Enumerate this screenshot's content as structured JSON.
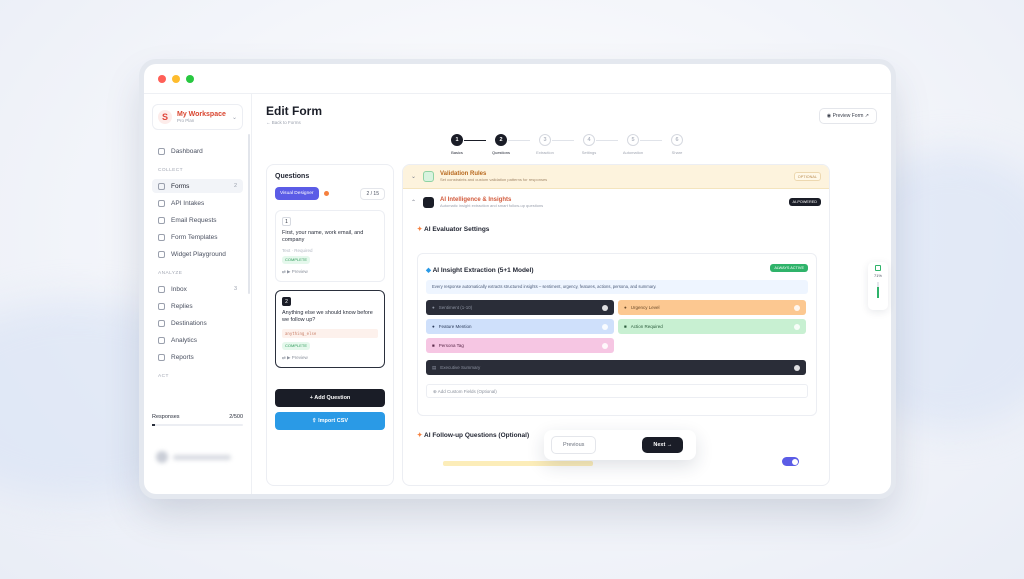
{
  "workspace": {
    "name": "My Workspace",
    "plan": "Pro Plan"
  },
  "sidebar": {
    "dashboard": "Dashboard",
    "sections": {
      "collect": "COLLECT",
      "analyze": "ANALYZE",
      "act": "ACT"
    },
    "collect_items": [
      {
        "label": "Forms",
        "count": "2"
      },
      {
        "label": "API Intakes",
        "count": ""
      },
      {
        "label": "Email Requests",
        "count": ""
      },
      {
        "label": "Form Templates",
        "count": ""
      },
      {
        "label": "Widget Playground",
        "count": ""
      }
    ],
    "analyze_items": [
      {
        "label": "Inbox",
        "count": "3"
      },
      {
        "label": "Replies",
        "count": ""
      },
      {
        "label": "Destinations",
        "count": ""
      },
      {
        "label": "Analytics",
        "count": ""
      },
      {
        "label": "Reports",
        "count": ""
      }
    ],
    "responses_label": "Responses",
    "responses_value": "2/500",
    "responses_fraction": 0.004
  },
  "header": {
    "title": "Edit Form",
    "back": "← Back to Forms",
    "preview": "Preview Form"
  },
  "steps": [
    {
      "num": "1",
      "label": "Basics",
      "done": true
    },
    {
      "num": "2",
      "label": "Questions",
      "done": true
    },
    {
      "num": "3",
      "label": "Extraction",
      "done": false
    },
    {
      "num": "4",
      "label": "Settings",
      "done": false
    },
    {
      "num": "5",
      "label": "Automation",
      "done": false
    },
    {
      "num": "6",
      "label": "Share",
      "done": false
    }
  ],
  "questions": {
    "title": "Questions",
    "designer": "Visual Designer",
    "count": "2 / 15",
    "items": [
      {
        "num": "1",
        "text": "First, your name, work email, and company",
        "meta": "Text · Required",
        "code": "",
        "status": "COMPLETE",
        "preview": "Preview"
      },
      {
        "num": "2",
        "text": "Anything else we should know before we follow up?",
        "meta": "",
        "code": "anything_else",
        "status": "COMPLETE",
        "preview": "Preview"
      }
    ],
    "add": "+ Add Question",
    "import": "Import CSV"
  },
  "validation": {
    "title": "Validation Rules",
    "subtitle": "Set constraints and custom validation patterns for responses",
    "badge": "OPTIONAL"
  },
  "ai": {
    "title": "AI Intelligence & Insights",
    "subtitle": "Automatic insight extraction and smart follow-up questions",
    "badge": "AI-POWERED"
  },
  "evaluator": {
    "title": "AI Evaluator Settings"
  },
  "extraction": {
    "title": "AI Insight Extraction (5+1 Model)",
    "badge": "ALWAYS ACTIVE",
    "info": "Every response automatically extracts structured insights – sentiment, urgency, features, actions, persona, and summary.",
    "fields": [
      {
        "label": "Sentiment (1-10)",
        "bg": "#2a2d38",
        "fg": "#8c92a0"
      },
      {
        "label": "Urgency Level",
        "bg": "#fcc891",
        "fg": "#6a4a2a"
      },
      {
        "label": "Feature Mention",
        "bg": "#cfe0fb",
        "fg": "#2a3a5a"
      },
      {
        "label": "Action Required",
        "bg": "#c8f0d2",
        "fg": "#2a5a3a"
      },
      {
        "label": "Persona Tag",
        "bg": "#f6c6e3",
        "fg": "#5a2a4a"
      },
      {
        "label": "Executive Summary",
        "bg": "#2a2d38",
        "fg": "#8c92a0"
      }
    ],
    "add_custom": "Add Custom Fields (Optional)"
  },
  "followup": {
    "title": "AI Follow-up Questions (Optional)"
  },
  "nav": {
    "previous": "Previous",
    "next": "Next →"
  },
  "progress": {
    "label": "71%",
    "value": 0.71
  },
  "colors": {
    "accent": "#5b5ce6",
    "brand": "#d9452f",
    "success": "#2fb36a",
    "dark": "#1a1d27"
  }
}
